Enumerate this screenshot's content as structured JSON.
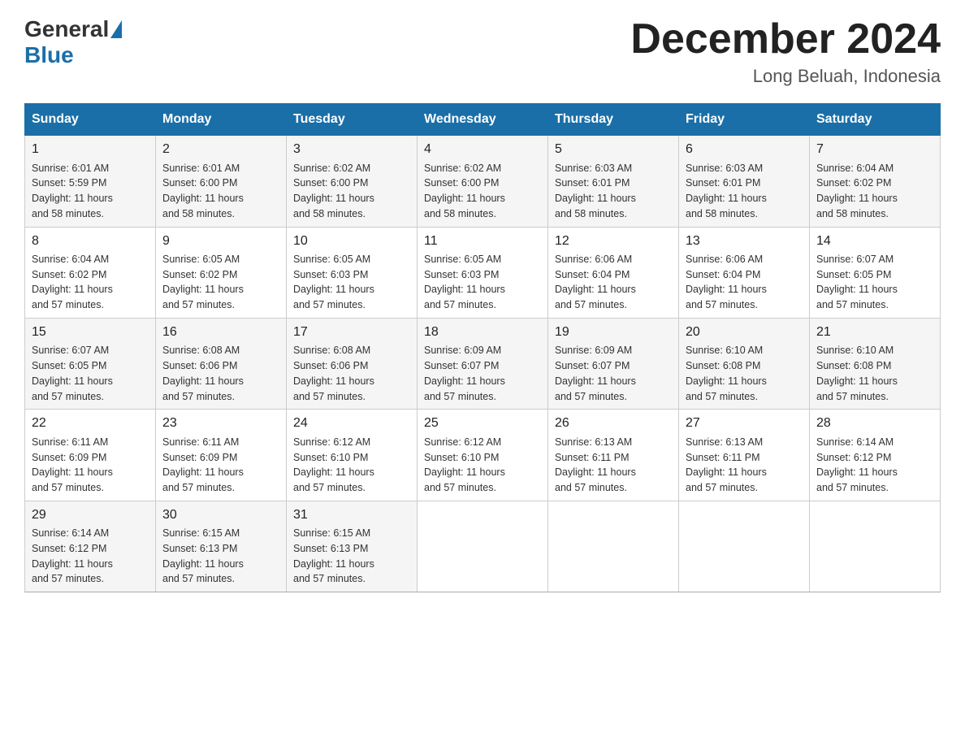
{
  "header": {
    "logo": {
      "general": "General",
      "blue": "Blue"
    },
    "title": "December 2024",
    "location": "Long Beluah, Indonesia"
  },
  "days_of_week": [
    "Sunday",
    "Monday",
    "Tuesday",
    "Wednesday",
    "Thursday",
    "Friday",
    "Saturday"
  ],
  "weeks": [
    [
      {
        "day": "1",
        "sunrise": "6:01 AM",
        "sunset": "5:59 PM",
        "daylight": "11 hours and 58 minutes."
      },
      {
        "day": "2",
        "sunrise": "6:01 AM",
        "sunset": "6:00 PM",
        "daylight": "11 hours and 58 minutes."
      },
      {
        "day": "3",
        "sunrise": "6:02 AM",
        "sunset": "6:00 PM",
        "daylight": "11 hours and 58 minutes."
      },
      {
        "day": "4",
        "sunrise": "6:02 AM",
        "sunset": "6:00 PM",
        "daylight": "11 hours and 58 minutes."
      },
      {
        "day": "5",
        "sunrise": "6:03 AM",
        "sunset": "6:01 PM",
        "daylight": "11 hours and 58 minutes."
      },
      {
        "day": "6",
        "sunrise": "6:03 AM",
        "sunset": "6:01 PM",
        "daylight": "11 hours and 58 minutes."
      },
      {
        "day": "7",
        "sunrise": "6:04 AM",
        "sunset": "6:02 PM",
        "daylight": "11 hours and 58 minutes."
      }
    ],
    [
      {
        "day": "8",
        "sunrise": "6:04 AM",
        "sunset": "6:02 PM",
        "daylight": "11 hours and 57 minutes."
      },
      {
        "day": "9",
        "sunrise": "6:05 AM",
        "sunset": "6:02 PM",
        "daylight": "11 hours and 57 minutes."
      },
      {
        "day": "10",
        "sunrise": "6:05 AM",
        "sunset": "6:03 PM",
        "daylight": "11 hours and 57 minutes."
      },
      {
        "day": "11",
        "sunrise": "6:05 AM",
        "sunset": "6:03 PM",
        "daylight": "11 hours and 57 minutes."
      },
      {
        "day": "12",
        "sunrise": "6:06 AM",
        "sunset": "6:04 PM",
        "daylight": "11 hours and 57 minutes."
      },
      {
        "day": "13",
        "sunrise": "6:06 AM",
        "sunset": "6:04 PM",
        "daylight": "11 hours and 57 minutes."
      },
      {
        "day": "14",
        "sunrise": "6:07 AM",
        "sunset": "6:05 PM",
        "daylight": "11 hours and 57 minutes."
      }
    ],
    [
      {
        "day": "15",
        "sunrise": "6:07 AM",
        "sunset": "6:05 PM",
        "daylight": "11 hours and 57 minutes."
      },
      {
        "day": "16",
        "sunrise": "6:08 AM",
        "sunset": "6:06 PM",
        "daylight": "11 hours and 57 minutes."
      },
      {
        "day": "17",
        "sunrise": "6:08 AM",
        "sunset": "6:06 PM",
        "daylight": "11 hours and 57 minutes."
      },
      {
        "day": "18",
        "sunrise": "6:09 AM",
        "sunset": "6:07 PM",
        "daylight": "11 hours and 57 minutes."
      },
      {
        "day": "19",
        "sunrise": "6:09 AM",
        "sunset": "6:07 PM",
        "daylight": "11 hours and 57 minutes."
      },
      {
        "day": "20",
        "sunrise": "6:10 AM",
        "sunset": "6:08 PM",
        "daylight": "11 hours and 57 minutes."
      },
      {
        "day": "21",
        "sunrise": "6:10 AM",
        "sunset": "6:08 PM",
        "daylight": "11 hours and 57 minutes."
      }
    ],
    [
      {
        "day": "22",
        "sunrise": "6:11 AM",
        "sunset": "6:09 PM",
        "daylight": "11 hours and 57 minutes."
      },
      {
        "day": "23",
        "sunrise": "6:11 AM",
        "sunset": "6:09 PM",
        "daylight": "11 hours and 57 minutes."
      },
      {
        "day": "24",
        "sunrise": "6:12 AM",
        "sunset": "6:10 PM",
        "daylight": "11 hours and 57 minutes."
      },
      {
        "day": "25",
        "sunrise": "6:12 AM",
        "sunset": "6:10 PM",
        "daylight": "11 hours and 57 minutes."
      },
      {
        "day": "26",
        "sunrise": "6:13 AM",
        "sunset": "6:11 PM",
        "daylight": "11 hours and 57 minutes."
      },
      {
        "day": "27",
        "sunrise": "6:13 AM",
        "sunset": "6:11 PM",
        "daylight": "11 hours and 57 minutes."
      },
      {
        "day": "28",
        "sunrise": "6:14 AM",
        "sunset": "6:12 PM",
        "daylight": "11 hours and 57 minutes."
      }
    ],
    [
      {
        "day": "29",
        "sunrise": "6:14 AM",
        "sunset": "6:12 PM",
        "daylight": "11 hours and 57 minutes."
      },
      {
        "day": "30",
        "sunrise": "6:15 AM",
        "sunset": "6:13 PM",
        "daylight": "11 hours and 57 minutes."
      },
      {
        "day": "31",
        "sunrise": "6:15 AM",
        "sunset": "6:13 PM",
        "daylight": "11 hours and 57 minutes."
      },
      null,
      null,
      null,
      null
    ]
  ],
  "labels": {
    "sunrise": "Sunrise:",
    "sunset": "Sunset:",
    "daylight": "Daylight:"
  }
}
